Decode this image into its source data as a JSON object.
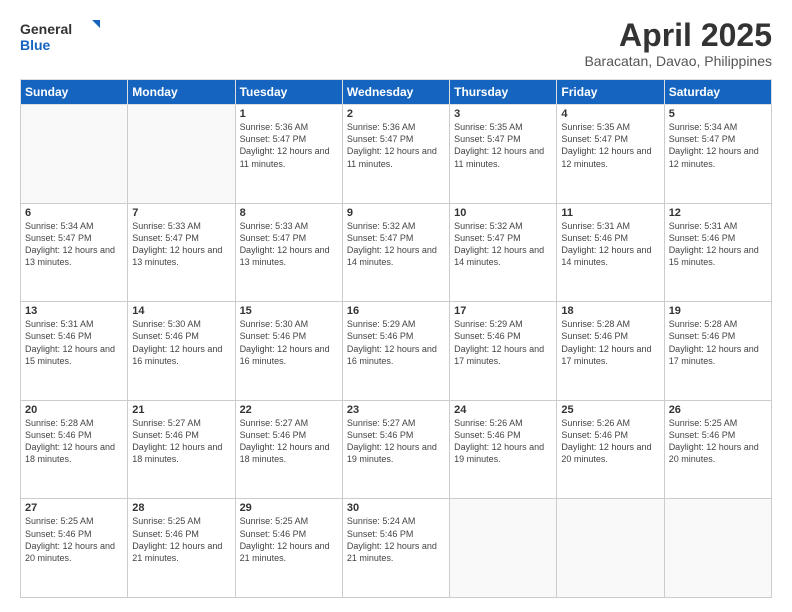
{
  "logo": {
    "line1": "General",
    "line2": "Blue"
  },
  "title": "April 2025",
  "subtitle": "Baracatan, Davao, Philippines",
  "header": {
    "days": [
      "Sunday",
      "Monday",
      "Tuesday",
      "Wednesday",
      "Thursday",
      "Friday",
      "Saturday"
    ]
  },
  "weeks": [
    [
      {
        "day": "",
        "info": ""
      },
      {
        "day": "",
        "info": ""
      },
      {
        "day": "1",
        "info": "Sunrise: 5:36 AM\nSunset: 5:47 PM\nDaylight: 12 hours and 11 minutes."
      },
      {
        "day": "2",
        "info": "Sunrise: 5:36 AM\nSunset: 5:47 PM\nDaylight: 12 hours and 11 minutes."
      },
      {
        "day": "3",
        "info": "Sunrise: 5:35 AM\nSunset: 5:47 PM\nDaylight: 12 hours and 11 minutes."
      },
      {
        "day": "4",
        "info": "Sunrise: 5:35 AM\nSunset: 5:47 PM\nDaylight: 12 hours and 12 minutes."
      },
      {
        "day": "5",
        "info": "Sunrise: 5:34 AM\nSunset: 5:47 PM\nDaylight: 12 hours and 12 minutes."
      }
    ],
    [
      {
        "day": "6",
        "info": "Sunrise: 5:34 AM\nSunset: 5:47 PM\nDaylight: 12 hours and 13 minutes."
      },
      {
        "day": "7",
        "info": "Sunrise: 5:33 AM\nSunset: 5:47 PM\nDaylight: 12 hours and 13 minutes."
      },
      {
        "day": "8",
        "info": "Sunrise: 5:33 AM\nSunset: 5:47 PM\nDaylight: 12 hours and 13 minutes."
      },
      {
        "day": "9",
        "info": "Sunrise: 5:32 AM\nSunset: 5:47 PM\nDaylight: 12 hours and 14 minutes."
      },
      {
        "day": "10",
        "info": "Sunrise: 5:32 AM\nSunset: 5:47 PM\nDaylight: 12 hours and 14 minutes."
      },
      {
        "day": "11",
        "info": "Sunrise: 5:31 AM\nSunset: 5:46 PM\nDaylight: 12 hours and 14 minutes."
      },
      {
        "day": "12",
        "info": "Sunrise: 5:31 AM\nSunset: 5:46 PM\nDaylight: 12 hours and 15 minutes."
      }
    ],
    [
      {
        "day": "13",
        "info": "Sunrise: 5:31 AM\nSunset: 5:46 PM\nDaylight: 12 hours and 15 minutes."
      },
      {
        "day": "14",
        "info": "Sunrise: 5:30 AM\nSunset: 5:46 PM\nDaylight: 12 hours and 16 minutes."
      },
      {
        "day": "15",
        "info": "Sunrise: 5:30 AM\nSunset: 5:46 PM\nDaylight: 12 hours and 16 minutes."
      },
      {
        "day": "16",
        "info": "Sunrise: 5:29 AM\nSunset: 5:46 PM\nDaylight: 12 hours and 16 minutes."
      },
      {
        "day": "17",
        "info": "Sunrise: 5:29 AM\nSunset: 5:46 PM\nDaylight: 12 hours and 17 minutes."
      },
      {
        "day": "18",
        "info": "Sunrise: 5:28 AM\nSunset: 5:46 PM\nDaylight: 12 hours and 17 minutes."
      },
      {
        "day": "19",
        "info": "Sunrise: 5:28 AM\nSunset: 5:46 PM\nDaylight: 12 hours and 17 minutes."
      }
    ],
    [
      {
        "day": "20",
        "info": "Sunrise: 5:28 AM\nSunset: 5:46 PM\nDaylight: 12 hours and 18 minutes."
      },
      {
        "day": "21",
        "info": "Sunrise: 5:27 AM\nSunset: 5:46 PM\nDaylight: 12 hours and 18 minutes."
      },
      {
        "day": "22",
        "info": "Sunrise: 5:27 AM\nSunset: 5:46 PM\nDaylight: 12 hours and 18 minutes."
      },
      {
        "day": "23",
        "info": "Sunrise: 5:27 AM\nSunset: 5:46 PM\nDaylight: 12 hours and 19 minutes."
      },
      {
        "day": "24",
        "info": "Sunrise: 5:26 AM\nSunset: 5:46 PM\nDaylight: 12 hours and 19 minutes."
      },
      {
        "day": "25",
        "info": "Sunrise: 5:26 AM\nSunset: 5:46 PM\nDaylight: 12 hours and 20 minutes."
      },
      {
        "day": "26",
        "info": "Sunrise: 5:25 AM\nSunset: 5:46 PM\nDaylight: 12 hours and 20 minutes."
      }
    ],
    [
      {
        "day": "27",
        "info": "Sunrise: 5:25 AM\nSunset: 5:46 PM\nDaylight: 12 hours and 20 minutes."
      },
      {
        "day": "28",
        "info": "Sunrise: 5:25 AM\nSunset: 5:46 PM\nDaylight: 12 hours and 21 minutes."
      },
      {
        "day": "29",
        "info": "Sunrise: 5:25 AM\nSunset: 5:46 PM\nDaylight: 12 hours and 21 minutes."
      },
      {
        "day": "30",
        "info": "Sunrise: 5:24 AM\nSunset: 5:46 PM\nDaylight: 12 hours and 21 minutes."
      },
      {
        "day": "",
        "info": ""
      },
      {
        "day": "",
        "info": ""
      },
      {
        "day": "",
        "info": ""
      }
    ]
  ]
}
